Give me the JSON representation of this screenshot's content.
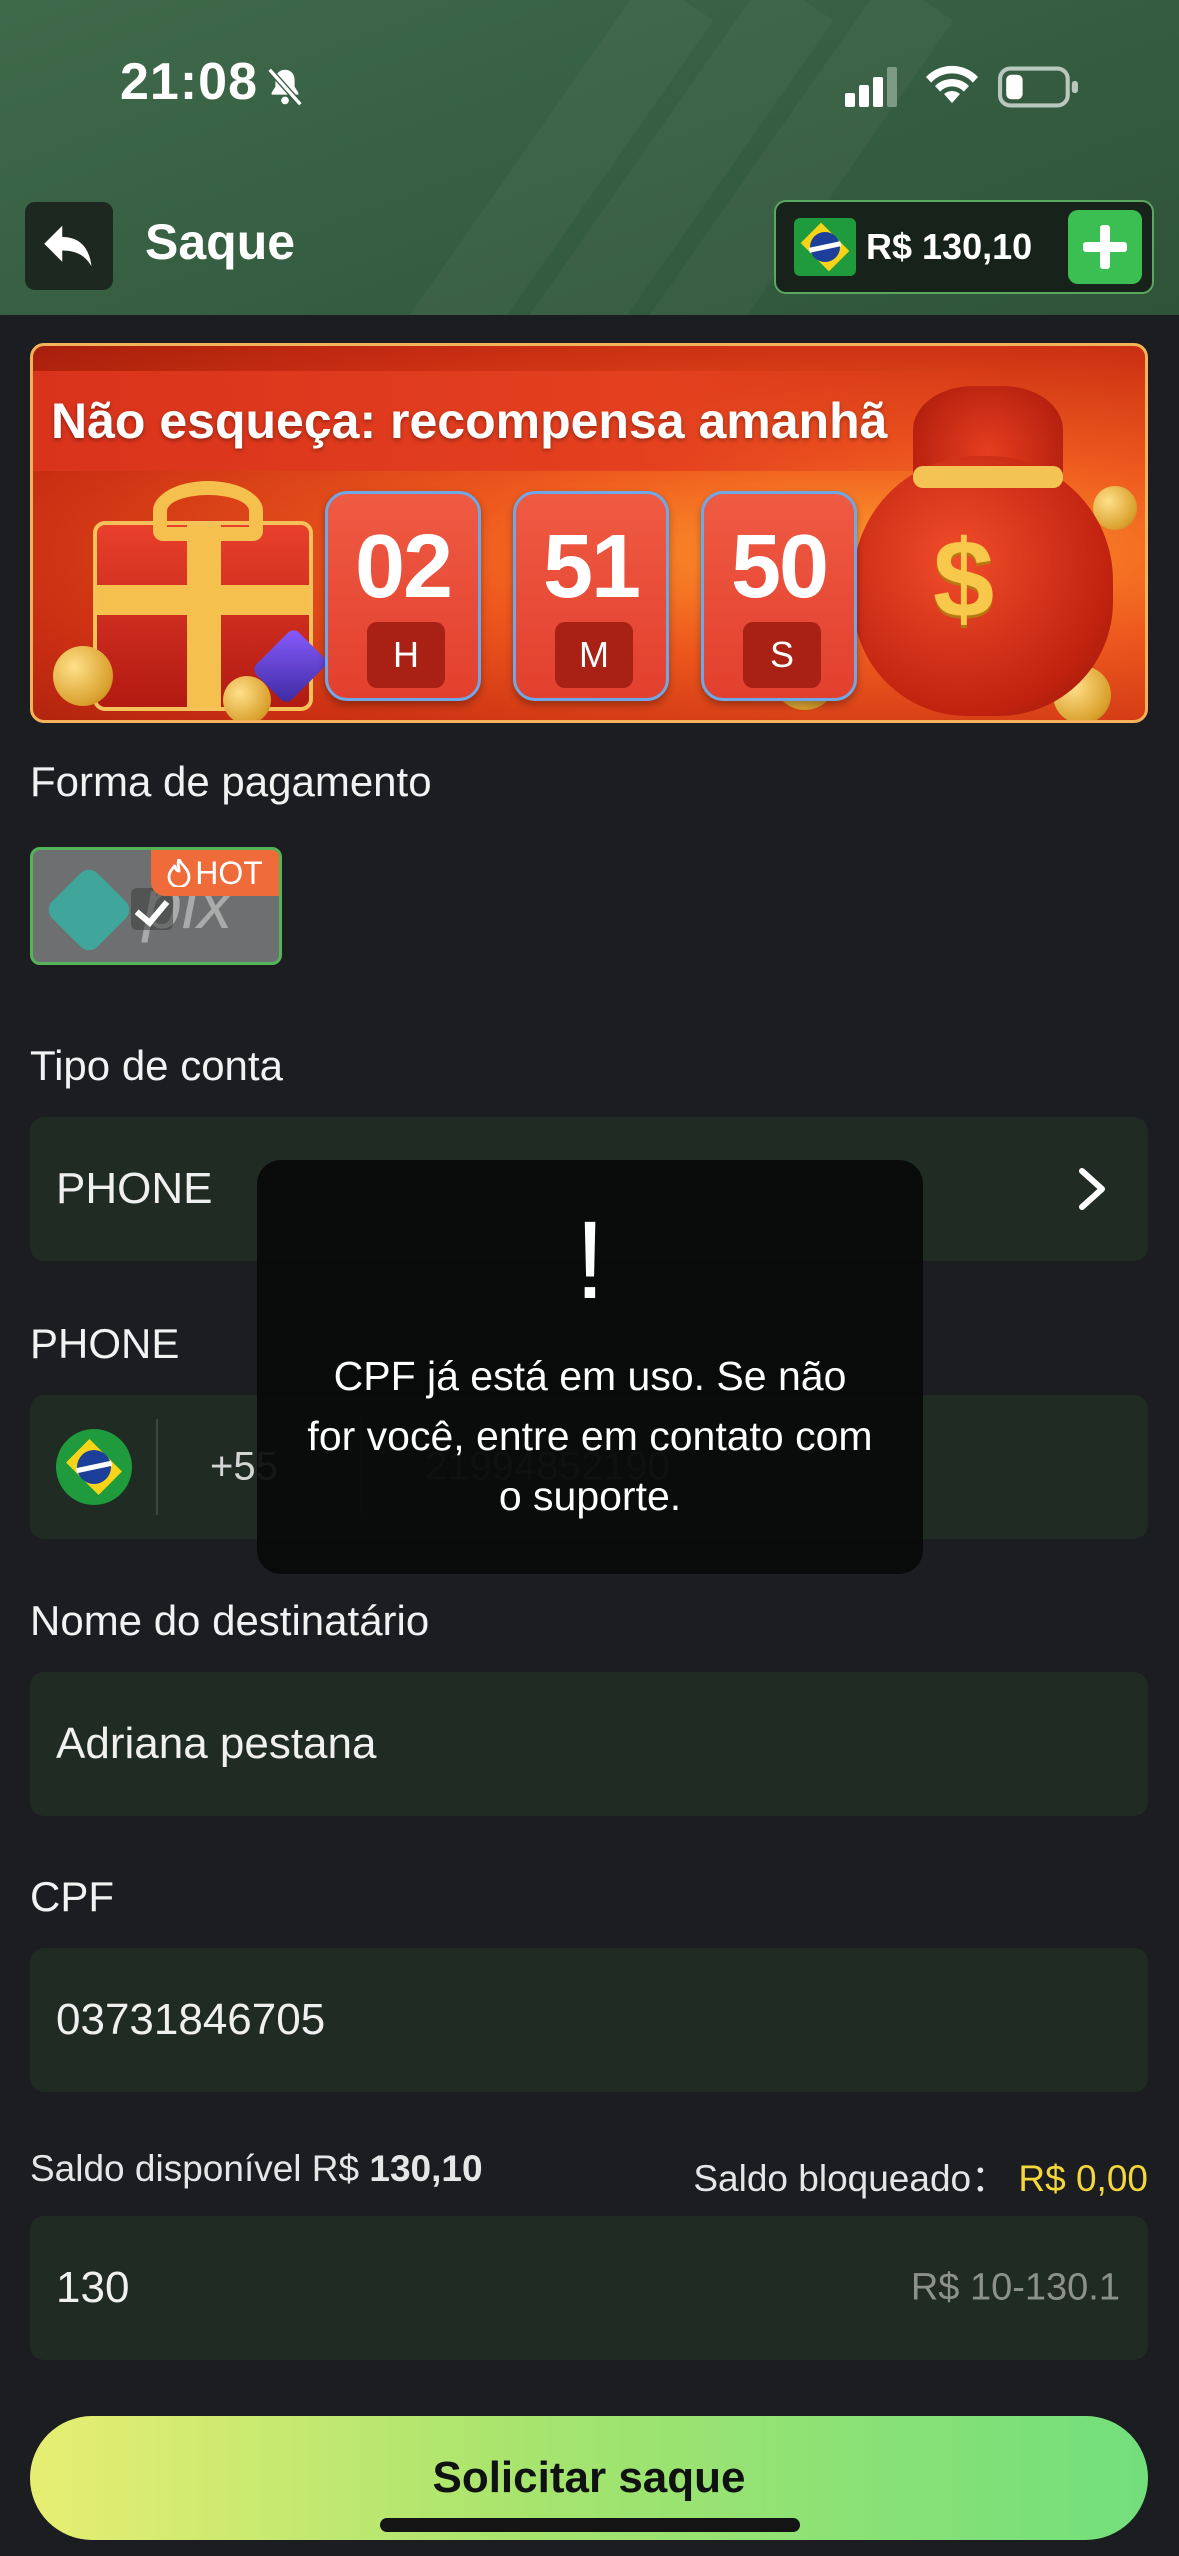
{
  "status_bar": {
    "time": "21:08"
  },
  "header": {
    "title": "Saque",
    "balance": "R$ 130,10"
  },
  "banner": {
    "title": "Não esqueça: recompensa amanhã",
    "timer": [
      {
        "value": "02",
        "unit": "H"
      },
      {
        "value": "51",
        "unit": "M"
      },
      {
        "value": "50",
        "unit": "S"
      }
    ]
  },
  "payment": {
    "label": "Forma de pagamento",
    "method": "pix",
    "badge": "HOT"
  },
  "account_type": {
    "label": "Tipo de conta",
    "value": "PHONE"
  },
  "phone": {
    "label": "PHONE",
    "code": "+55",
    "number": "21994852190"
  },
  "recipient": {
    "label": "Nome do destinatário",
    "value": "Adriana pestana"
  },
  "cpf": {
    "label": "CPF",
    "value": "03731846705"
  },
  "saldo": {
    "available_label": "Saldo disponível R$",
    "available_value": "130,10",
    "blocked_label": "Saldo bloqueado：",
    "blocked_value": "R$ 0,00"
  },
  "amount": {
    "value": "130",
    "range": "R$ 10-130.1"
  },
  "submit_label": "Solicitar saque",
  "toast": {
    "icon": "!",
    "message": "CPF já está em uso. Se não for você, entre em contato com o suporte."
  },
  "colors": {
    "accent_green": "#3bbf52",
    "blocked_yellow": "#f4d73a",
    "field_bg": "#1f2b23"
  },
  "icons": [
    "bell-off-icon",
    "signal-icon",
    "wifi-icon",
    "battery-icon",
    "back-arrow-icon",
    "plus-icon",
    "chevron-right-icon",
    "check-icon",
    "fire-icon",
    "exclamation-icon"
  ]
}
